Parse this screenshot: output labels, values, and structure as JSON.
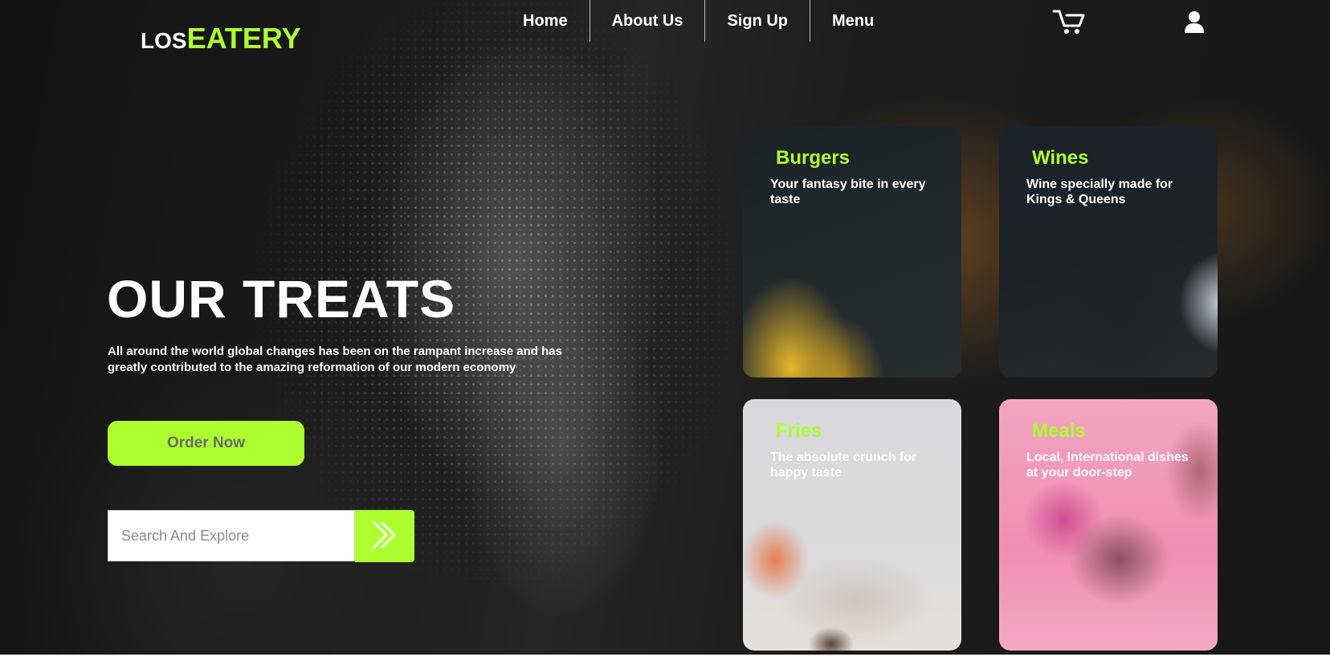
{
  "logo": {
    "prefix": "LOS",
    "main": "EATERY"
  },
  "nav": {
    "items": [
      {
        "label": "Home"
      },
      {
        "label": "About Us"
      },
      {
        "label": "Sign Up"
      },
      {
        "label": "Menu"
      }
    ],
    "icons": [
      "cart-icon",
      "user-icon"
    ]
  },
  "hero": {
    "title": "OUR TREATS",
    "description": "All around the world global changes has been on the rampant increase and has greatly contributed to the amazing reformation of our modern economy",
    "order_button": "Order Now",
    "search": {
      "placeholder": "Search And Explore",
      "value": "",
      "button_icon": "double-chevron-right-icon"
    }
  },
  "cards": [
    {
      "title": "Burgers",
      "description": "Your fantasy bite in every taste"
    },
    {
      "title": "Wines",
      "description": "Wine specially made for Kings & Queens"
    },
    {
      "title": "Fries",
      "description": "The absolute crunch for happy taste"
    },
    {
      "title": "Meals",
      "description": "Local, International dishes at your door-step"
    }
  ],
  "colors": {
    "accent": "#adff2f",
    "background": "#1a1a1a",
    "text": "#ffffff",
    "button_text": "#6b6b6b"
  }
}
